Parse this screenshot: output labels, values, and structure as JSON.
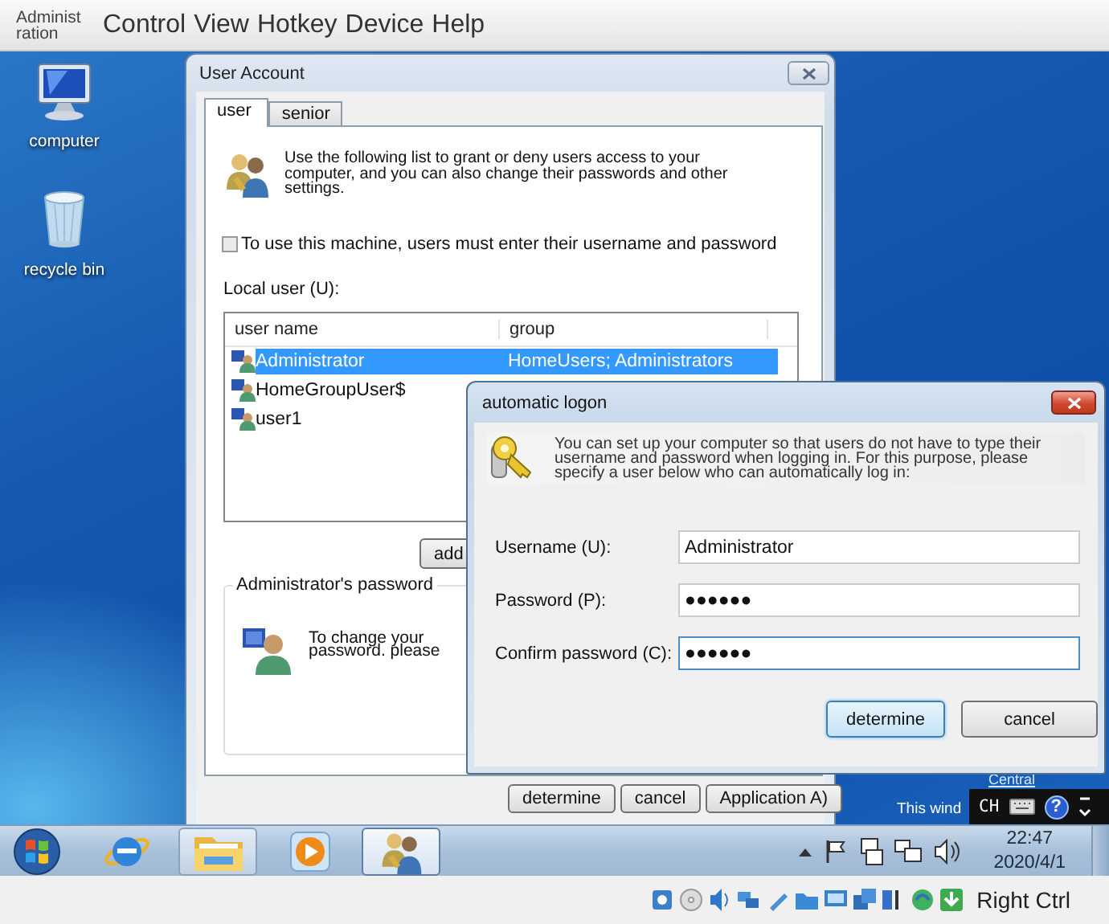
{
  "vm_menu": {
    "machine_label": "Administration",
    "menus": [
      "Control",
      "View",
      "Hotkey",
      "Device",
      "Help"
    ]
  },
  "desktop_icons": [
    {
      "kind": "computer",
      "label": "computer"
    },
    {
      "kind": "recycle_bin",
      "label": "recycle bin"
    }
  ],
  "user_account": {
    "title": "User Account",
    "tabs": [
      {
        "label": "user",
        "selected": true
      },
      {
        "label": "senior",
        "selected": false
      }
    ],
    "intro": "Use the following list to grant or deny users access to your computer, and you can also change their passwords and other settings.",
    "require_login": {
      "label": "To use this machine, users must enter their username and password",
      "checked": false
    },
    "local_user_label": "Local user (U):",
    "columns": [
      "user name",
      "group"
    ],
    "users": [
      {
        "name": "Administrator",
        "group": "HomeUsers; Administrators",
        "selected": true
      },
      {
        "name": "HomeGroupUser$",
        "selected": false
      },
      {
        "name": "user1",
        "selected": false
      }
    ],
    "add_button": "add",
    "password_group": {
      "title": "Administrator's password",
      "text": "To change your password. please"
    },
    "buttons": [
      "determine",
      "cancel",
      "Application A)"
    ]
  },
  "auto_logon": {
    "title": "automatic logon",
    "info": "You can set up your computer so that users do not have to type their username and password when logging in. For this purpose, please specify a user below who can automatically log in:",
    "fields": [
      {
        "label": "Username (U):",
        "value": "Administrator",
        "focused": false
      },
      {
        "label": "Password (P):",
        "value": "●●●●●●",
        "focused": false
      },
      {
        "label": "Confirm password (C):",
        "value": "●●●●●●",
        "focused": true
      }
    ],
    "buttons": [
      {
        "label": "determine",
        "default": true
      },
      {
        "label": "cancel",
        "default": false
      }
    ]
  },
  "background_notice": {
    "title": "Central",
    "text": "This wind"
  },
  "language_bar": {
    "language": "CH",
    "help": "?"
  },
  "taskbar": {
    "apps": [
      {
        "kind": "browser",
        "open": false,
        "selected": false
      },
      {
        "kind": "folder",
        "open": true,
        "selected": false
      },
      {
        "kind": "media",
        "open": false,
        "selected": false
      },
      {
        "kind": "users",
        "open": true,
        "selected": true
      }
    ],
    "time": "22:47",
    "date": "2020/4/1"
  },
  "vm_status": {
    "host_key": "Right Ctrl"
  }
}
